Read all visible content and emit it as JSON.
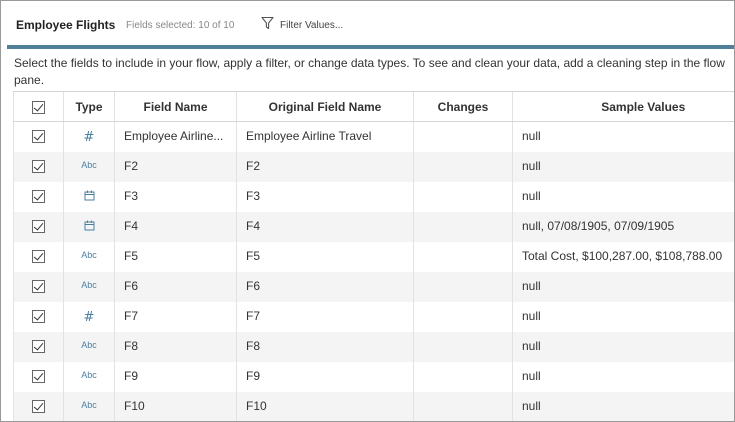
{
  "header": {
    "title": "Employee Flights",
    "fields_selected": "Fields selected: 10 of 10",
    "filter_label": "Filter Values..."
  },
  "instructions": "Select the fields to include in your flow, apply a filter, or change data types. To see and clean your data, add a cleaning step in the flow pane.",
  "columns": {
    "type": "Type",
    "field_name": "Field Name",
    "original_field_name": "Original Field Name",
    "changes": "Changes",
    "sample_values": "Sample Values"
  },
  "rows": [
    {
      "checked": true,
      "type": "number",
      "field_name": "Employee Airline...",
      "original": "Employee Airline Travel",
      "changes": "",
      "sample": "null"
    },
    {
      "checked": true,
      "type": "string",
      "field_name": "F2",
      "original": "F2",
      "changes": "",
      "sample": "null"
    },
    {
      "checked": true,
      "type": "date",
      "field_name": "F3",
      "original": "F3",
      "changes": "",
      "sample": "null"
    },
    {
      "checked": true,
      "type": "date",
      "field_name": "F4",
      "original": "F4",
      "changes": "",
      "sample": "null, 07/08/1905, 07/09/1905"
    },
    {
      "checked": true,
      "type": "string",
      "field_name": "F5",
      "original": "F5",
      "changes": "",
      "sample": "Total Cost, $100,287.00, $108,788.00"
    },
    {
      "checked": true,
      "type": "string",
      "field_name": "F6",
      "original": "F6",
      "changes": "",
      "sample": "null"
    },
    {
      "checked": true,
      "type": "number",
      "field_name": "F7",
      "original": "F7",
      "changes": "",
      "sample": "null"
    },
    {
      "checked": true,
      "type": "string",
      "field_name": "F8",
      "original": "F8",
      "changes": "",
      "sample": "null"
    },
    {
      "checked": true,
      "type": "string",
      "field_name": "F9",
      "original": "F9",
      "changes": "",
      "sample": "null"
    },
    {
      "checked": true,
      "type": "string",
      "field_name": "F10",
      "original": "F10",
      "changes": "",
      "sample": "null"
    }
  ],
  "type_icons": {
    "number": "hash-icon",
    "string": "abc-icon",
    "date": "calendar-icon"
  },
  "type_icon_text": {
    "number": "#",
    "string": "Abc"
  },
  "colors": {
    "accent_bar": "#4f7f9b",
    "type_icon": "#4a7fa0",
    "row_alt": "#f4f4f4"
  }
}
